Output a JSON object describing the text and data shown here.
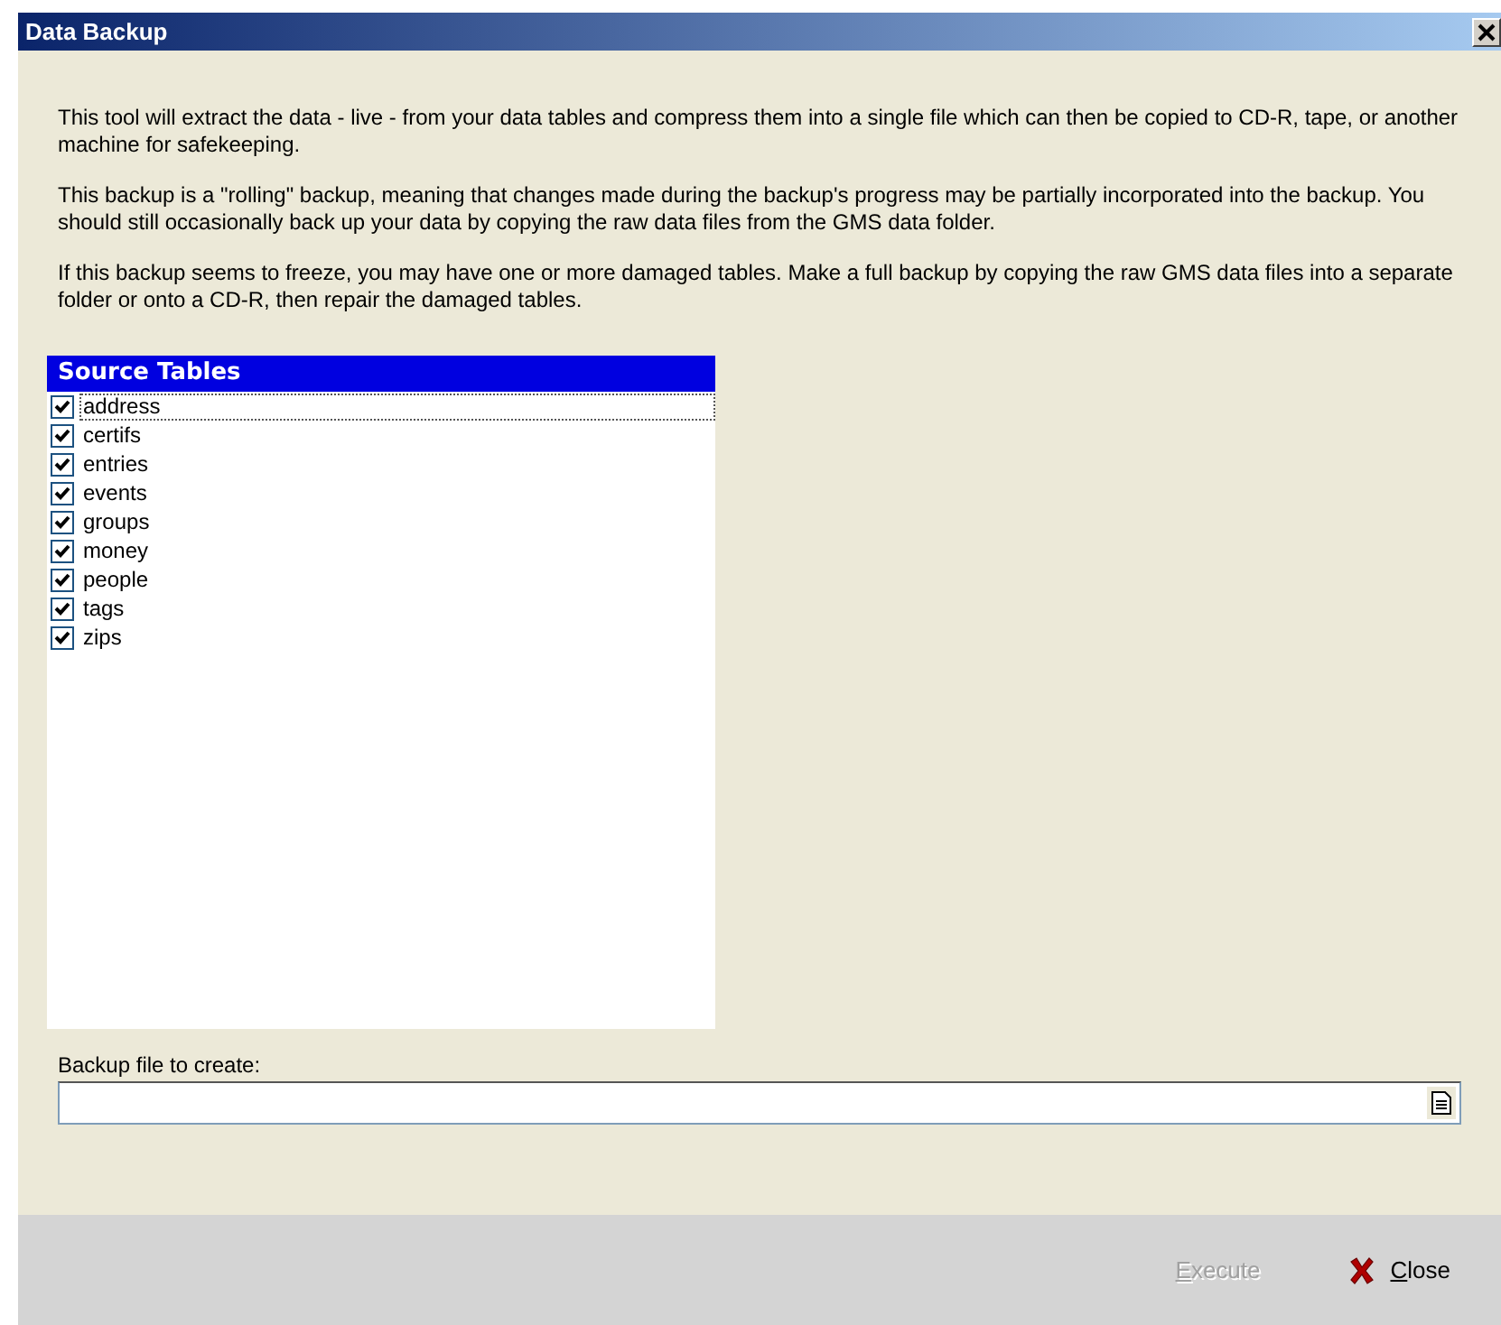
{
  "window": {
    "title": "Data Backup"
  },
  "paragraphs": [
    "This tool will extract the data - live - from your data tables and compress them into a single file which can then be copied to CD-R, tape, or another machine for safekeeping.",
    "This backup is a \"rolling\" backup, meaning that changes made during the backup's progress may be partially incorporated into the backup. You should still occasionally back up your data by copying the raw data files from the GMS data folder.",
    "If this backup seems to freeze, you may have one or more damaged tables. Make a full backup by copying the raw GMS data files into a separate folder or onto a CD-R, then repair the damaged tables."
  ],
  "source_tables": {
    "title": "Source Tables",
    "items": [
      {
        "label": "address",
        "checked": true,
        "focused": true
      },
      {
        "label": "certifs",
        "checked": true,
        "focused": false
      },
      {
        "label": "entries",
        "checked": true,
        "focused": false
      },
      {
        "label": "events",
        "checked": true,
        "focused": false
      },
      {
        "label": "groups",
        "checked": true,
        "focused": false
      },
      {
        "label": "money",
        "checked": true,
        "focused": false
      },
      {
        "label": "people",
        "checked": true,
        "focused": false
      },
      {
        "label": "tags",
        "checked": true,
        "focused": false
      },
      {
        "label": "zips",
        "checked": true,
        "focused": false
      }
    ]
  },
  "backup_file": {
    "label": "Backup file to create:"
  },
  "buttons": [
    {
      "label": "Execute",
      "kind": "execute",
      "disabled": true
    },
    {
      "label": "Close",
      "kind": "close",
      "disabled": false
    }
  ]
}
